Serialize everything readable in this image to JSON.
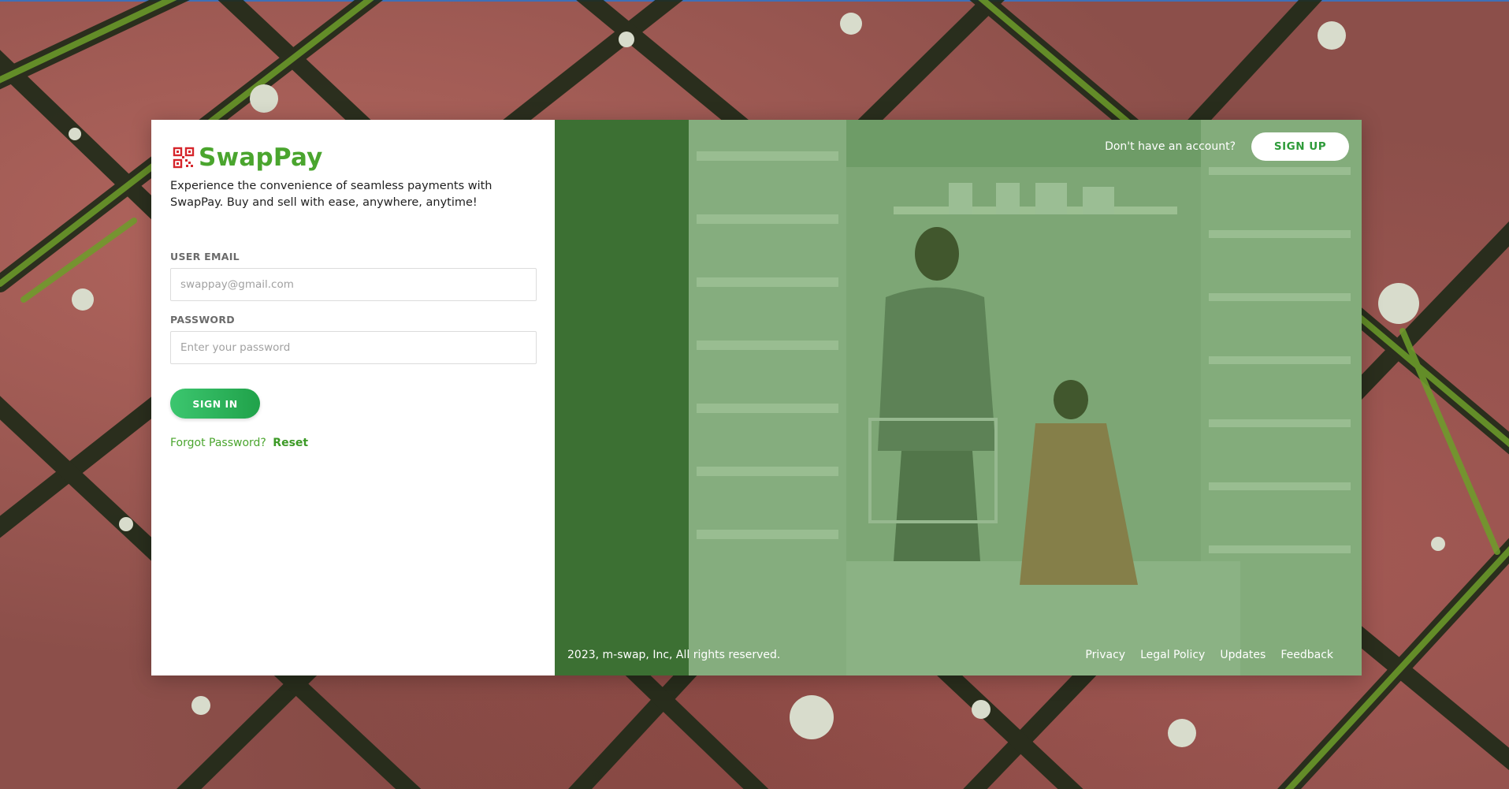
{
  "brand": {
    "name": "SwapPay",
    "tagline": "Experience the convenience of seamless payments with SwapPay. Buy and sell with ease, anywhere, anytime!"
  },
  "form": {
    "email_label": "USER EMAIL",
    "email_placeholder": "swappay@gmail.com",
    "password_label": "PASSWORD",
    "password_placeholder": "Enter your password",
    "signin_label": "SIGN IN",
    "forgot_text": "Forgot Password?",
    "reset_label": "Reset"
  },
  "header": {
    "no_account_text": "Don't have an account?",
    "signup_label": "SIGN UP"
  },
  "footer": {
    "copyright": "2023, m-swap, Inc, All rights reserved.",
    "links": [
      "Privacy",
      "Legal Policy",
      "Updates",
      "Feedback"
    ]
  },
  "colors": {
    "brand_green": "#4aa52e",
    "button_green": "#2ab35a",
    "overlay_green": "#488c3c",
    "logo_red": "#d6262c"
  },
  "icons": {
    "brand_logo": "qr-code-icon"
  }
}
